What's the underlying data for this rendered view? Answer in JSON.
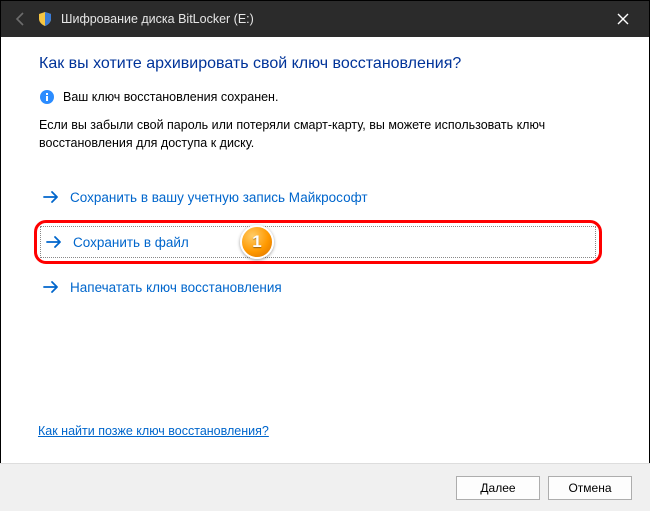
{
  "titlebar": {
    "title": "Шифрование диска BitLocker (E:)"
  },
  "heading": "Как вы хотите архивировать свой ключ восстановления?",
  "info": "Ваш ключ восстановления сохранен.",
  "description": "Если вы забыли свой пароль или потеряли смарт-карту, вы можете использовать ключ восстановления для доступа к диску.",
  "options": [
    {
      "label": "Сохранить в вашу учетную запись Майкрософт"
    },
    {
      "label": "Сохранить в файл"
    },
    {
      "label": "Напечатать ключ восстановления"
    }
  ],
  "annotation_badge": "1",
  "help_link": "Как найти позже ключ восстановления?",
  "footer": {
    "next": "Далее",
    "cancel": "Отмена"
  }
}
